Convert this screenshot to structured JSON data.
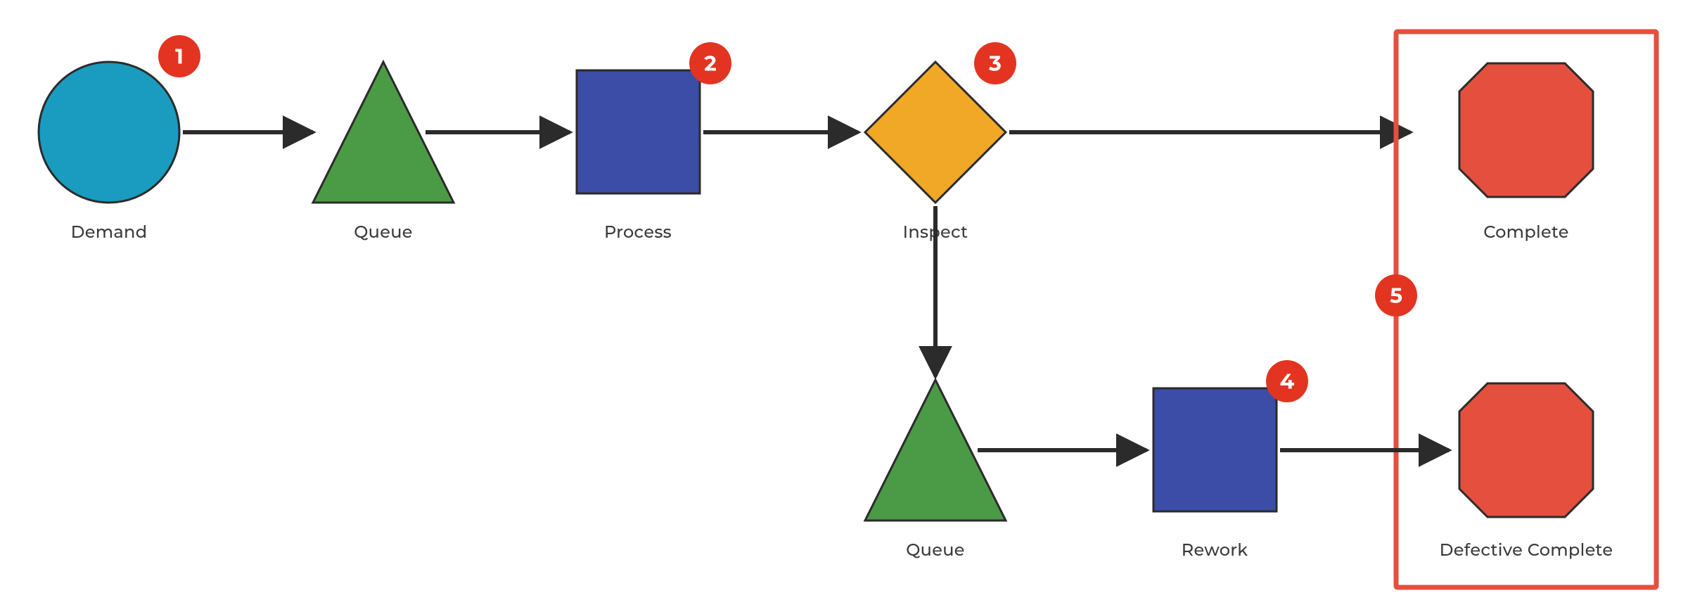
{
  "colors": {
    "demand": "#199CBF",
    "queue": "#4B9A45",
    "process": "#3C4DA7",
    "inspect": "#F0A826",
    "end": "#E44F3E",
    "stroke": "#2B2B2B",
    "badge": "#E33421",
    "box": "#E44F3E"
  },
  "nodes": {
    "demand": {
      "label": "Demand",
      "badge": "1"
    },
    "queue1": {
      "label": "Queue",
      "badge": ""
    },
    "process": {
      "label": "Process",
      "badge": "2"
    },
    "inspect": {
      "label": "Inspect",
      "badge": "3"
    },
    "complete": {
      "label": "Complete",
      "badge": ""
    },
    "queue2": {
      "label": "Queue",
      "badge": ""
    },
    "rework": {
      "label": "Rework",
      "badge": "4"
    },
    "defective": {
      "label": "Defective Complete",
      "badge": ""
    }
  },
  "group_badge": "5"
}
